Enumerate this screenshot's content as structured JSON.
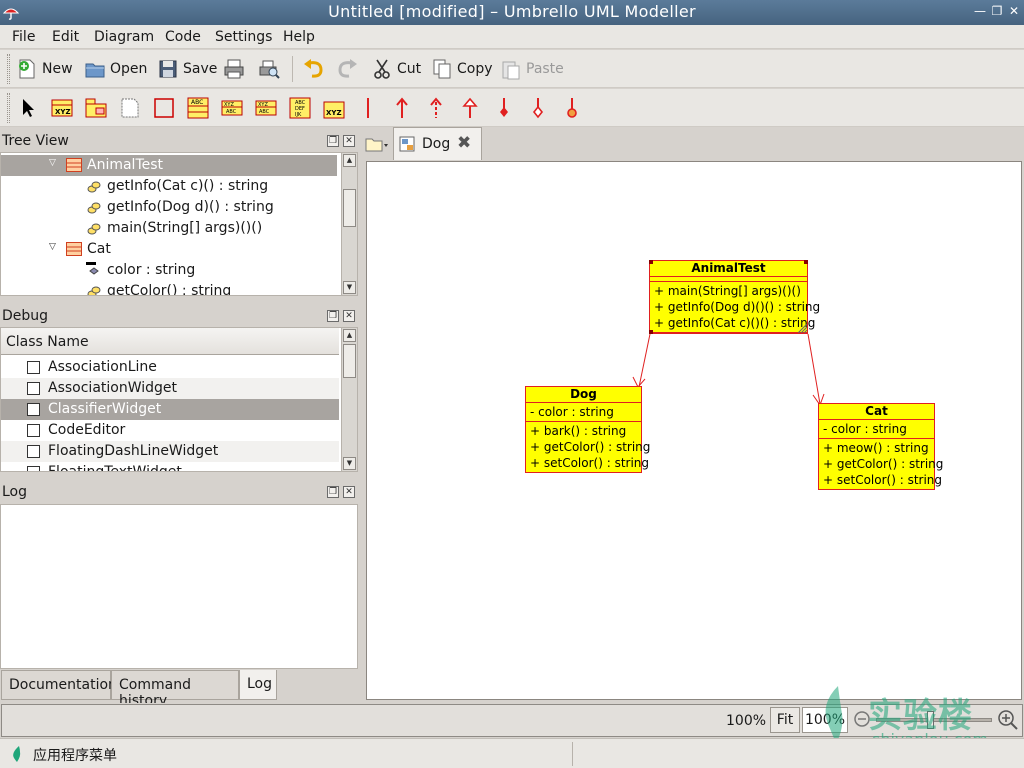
{
  "window": {
    "title": "Untitled [modified] – Umbrello UML Modeller",
    "controls": [
      "minimize-icon",
      "restore-icon",
      "close-icon"
    ]
  },
  "menu": [
    "File",
    "Edit",
    "Diagram",
    "Code",
    "Settings",
    "Help"
  ],
  "toolbar": {
    "new": "New",
    "open": "Open",
    "save": "Save",
    "cut": "Cut",
    "copy": "Copy",
    "paste": "Paste"
  },
  "tree_view": {
    "title": "Tree View",
    "items": [
      {
        "label": "AnimalTest",
        "kind": "class",
        "selected": true
      },
      {
        "label": "getInfo(Cat c)() : string",
        "kind": "operation"
      },
      {
        "label": "getInfo(Dog d)() : string",
        "kind": "operation"
      },
      {
        "label": "main(String[] args)()()",
        "kind": "operation"
      },
      {
        "label": "Cat",
        "kind": "class"
      },
      {
        "label": "color : string",
        "kind": "attribute"
      },
      {
        "label": "getColor() : string",
        "kind": "operation"
      }
    ]
  },
  "debug": {
    "title": "Debug",
    "column": "Class Name",
    "items": [
      {
        "label": "AssociationLine",
        "checked": false
      },
      {
        "label": "AssociationWidget",
        "checked": false
      },
      {
        "label": "ClassifierWidget",
        "checked": false,
        "selected": true
      },
      {
        "label": "CodeEditor",
        "checked": false
      },
      {
        "label": "FloatingDashLineWidget",
        "checked": false
      },
      {
        "label": "FloatingTextWidget",
        "checked": false
      }
    ]
  },
  "log": {
    "title": "Log",
    "tabs": [
      "Documentation",
      "Command history",
      "Log"
    ],
    "active_tab": "Log"
  },
  "diagram": {
    "tab_label": "Dog",
    "classes": [
      {
        "name": "AnimalTest",
        "attributes": [],
        "operations": [
          "+ main(String[] args)()()",
          "+ getInfo(Dog d)()() : string",
          "+ getInfo(Cat c)()() : string"
        ]
      },
      {
        "name": "Dog",
        "attributes": [
          "- color : string"
        ],
        "operations": [
          "+ bark() : string",
          "+ getColor() : string",
          "+ setColor() : string"
        ]
      },
      {
        "name": "Cat",
        "attributes": [
          "- color : string"
        ],
        "operations": [
          "+ meow() : string",
          "+ getColor() : string",
          "+ setColor() : string"
        ]
      }
    ],
    "associations": [
      {
        "from": "AnimalTest",
        "to": "Dog"
      },
      {
        "from": "AnimalTest",
        "to": "Cat"
      }
    ],
    "colors": {
      "fill": "#ffff00",
      "line": "#e02020"
    }
  },
  "status": {
    "zoom_display": "100%",
    "fit_label": "Fit",
    "zoom_field": "100%"
  },
  "watermark": {
    "brand": "实验楼",
    "site": "shiyanlou.com"
  },
  "taskbar": {
    "start_menu": "应用程序菜单"
  }
}
